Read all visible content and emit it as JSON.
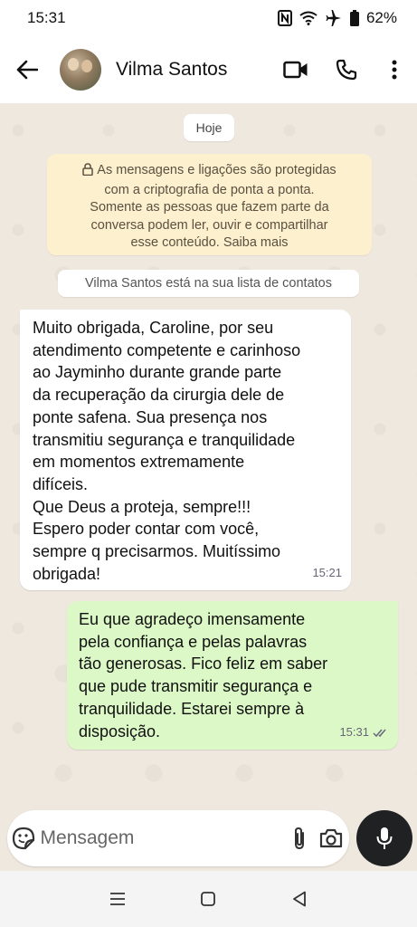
{
  "status_bar": {
    "time": "15:31",
    "battery": "62%",
    "icons": [
      "nfc-icon",
      "wifi-icon",
      "airplane-icon",
      "battery-icon"
    ]
  },
  "header": {
    "contact_name": "Vilma Santos",
    "icons": [
      "back-arrow-icon",
      "video-call-icon",
      "phone-icon",
      "more-options-icon"
    ]
  },
  "chat": {
    "date_chip": "Hoje",
    "encryption_notice": "As mensagens e ligações são protegidas\ncom a criptografia de ponta a ponta.\nSomente as pessoas que fazem parte da\nconversa podem ler, ouvir e compartilhar\nesse conteúdo. Saiba mais",
    "contact_notice": "Vilma Santos está na sua lista de contatos",
    "messages": [
      {
        "direction": "incoming",
        "text": "Muito obrigada, Caroline, por seu\natendimento competente e carinhoso\nao Jayminho durante  grande parte\nda recuperação da cirurgia dele de\nponte safena. Sua presença nos\ntransmitiu segurança e tranquilidade\nem momentos extremamente\ndifíceis.\nQue Deus a proteja, sempre!!!\nEspero poder contar com você,\nsempre q precisarmos. Muitíssimo\nobrigada!",
        "time": "15:21"
      },
      {
        "direction": "outgoing",
        "text": "Eu que agradeço imensamente\npela confiança e pelas palavras\ntão generosas. Fico feliz em saber\nque pude transmitir segurança e\ntranquilidade. Estarei sempre à\ndisposição.",
        "time": "15:31",
        "status": "read"
      }
    ]
  },
  "input_bar": {
    "placeholder": "Mensagem",
    "value": ""
  },
  "colors": {
    "chat_background": "#efe8df",
    "outgoing_bubble": "#dcf8c6",
    "incoming_bubble": "#ffffff",
    "encryption_notice": "#fdf0cf",
    "mic_button": "#1f2123"
  }
}
